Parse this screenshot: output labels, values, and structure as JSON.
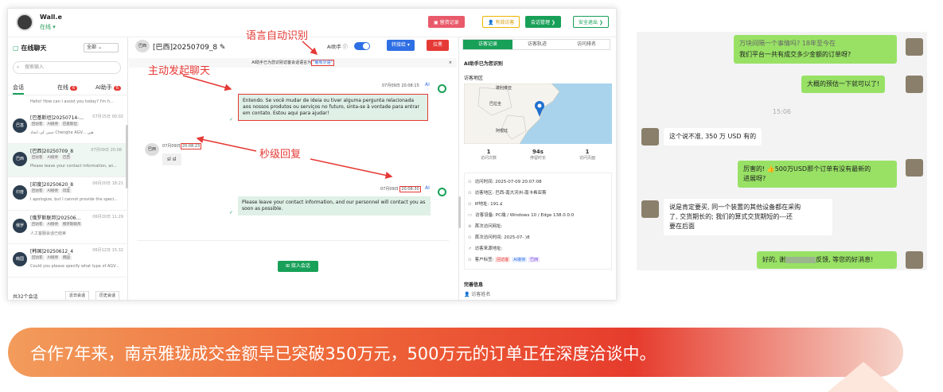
{
  "topbar": {
    "user_name": "Wall.e",
    "user_status": "在线 ▾",
    "btn_leave_record": "▣ 留资记录",
    "btn_visitor": "👤 有效访客",
    "btn_session_mgmt": "会话管理 ❯",
    "btn_safe_exit": "安全退出 ❯"
  },
  "left": {
    "title": "在线聊天",
    "filter": "全部",
    "search_placeholder": "搜索输入",
    "tabs": [
      {
        "label": "会话",
        "badge": ""
      },
      {
        "label": "在线",
        "badge": "6"
      },
      {
        "label": "AI助手",
        "badge": "6"
      }
    ],
    "first_preview": "Hello! How can I assist you today? I'm h...",
    "conversations": [
      {
        "avatar": "巴基",
        "title": "[巴基斯坦]20250714-...",
        "time": "07月15日 00:02",
        "tags": [
          "回访客",
          "AI接待",
          "巴基斯坦"
        ],
        "msg": "چینی کی اتحاد Chenghe AGV... هیں"
      },
      {
        "avatar": "巴西",
        "title": "[巴西]20250709_8",
        "time": "07月09日 20:08",
        "tags": [
          "回访客",
          "AI接待",
          "巴西"
        ],
        "msg": "Please leave your contact information, an..."
      },
      {
        "avatar": "印度",
        "title": "[印度]20250620_8",
        "time": "06月20日 18:21",
        "tags": [
          "回访客",
          "AI接待",
          "印度"
        ],
        "msg": "I apologize, but I cannot provide the speci..."
      },
      {
        "avatar": "俄罗",
        "title": "[俄罗斯联邦]202506...",
        "time": "06月20日 11:29",
        "tags": [
          "回访客",
          "AI接待",
          "俄罗斯联邦"
        ],
        "msg": "人工客服会话已结束"
      },
      {
        "avatar": "韩国",
        "title": "[韩国]20250612_4",
        "time": "06月12日 15:32",
        "tags": [
          "回访客",
          "AI接待",
          "韩国"
        ],
        "msg": "Could you please specify what type of AGV..."
      }
    ],
    "total": "共32个会话",
    "btn_recent": "近日会话",
    "btn_history": "历史会话"
  },
  "chat": {
    "avatar": "巴西",
    "title": "[巴西]20250709_8 ✎",
    "ai_label": "AI助手 ⓘ",
    "btn_transfer": "转接给 ▾",
    "btn_block": "拉黑",
    "notice_prefix": "AI助手已为您识别访客会话语言为",
    "notice_lang": "\"葡萄牙语\"",
    "close": "×",
    "msg1_time": "07月09日 20:08:15",
    "msg1_ai": "AI",
    "msg1_text": "Entendo. Se você mudar de ideia ou tiver alguma pergunta relacionada aos nossos produtos ou serviços no futuro, sinta-se à vontade para entrar em contato. Estou aqui para ajudar!",
    "visitor_avatar": "巴西",
    "msg2_date": "07月09日",
    "msg2_time": "20:08:23",
    "msg2_text": "sl sl",
    "msg3_date": "07月09日",
    "msg3_time": "20:08:30",
    "msg3_ai": "AI",
    "msg3_text": "Please leave your contact information, and our personnel will contact you as soon as possible.",
    "btn_accept": "⊞ 接入会话"
  },
  "right": {
    "tabs": [
      "访客记录",
      "访客轨迹",
      "访问排名"
    ],
    "ai_recog": "AI助手已为您识别",
    "region_label": "访客地区",
    "map_labels": [
      "玻利维亚",
      "巴拉圭",
      "阿根廷"
    ],
    "stats": [
      {
        "value": "1",
        "label": "访问次数"
      },
      {
        "value": "94s",
        "label": "停留时长"
      },
      {
        "value": "1",
        "label": "访问页面"
      }
    ],
    "info": [
      {
        "icon": "⊙",
        "text": "访问时间:  2025-07-09 20:07:08"
      },
      {
        "icon": "⊙",
        "text": "访客地区:  巴西-南大河州-南卡希亚斯"
      },
      {
        "icon": "⊙",
        "text": "IP地址:  191.£"
      },
      {
        "icon": "▭",
        "text": "访客设备:  PC端 / Windows 10 / Edge 138.0.0.0"
      },
      {
        "icon": "⊕",
        "text": "首次访问网址:"
      },
      {
        "icon": "⊙",
        "text": "首次访问时间:  2025-07-       )8"
      },
      {
        "icon": "➚",
        "text": "访客来源地址:"
      }
    ],
    "tag_label": "客户标签:",
    "tags": [
      "回访客",
      "AI接待",
      "巴西"
    ],
    "leave_info": "完善信息",
    "visitor_name": "访客姓名"
  },
  "annotations": {
    "lang_auto": "语言自动识别",
    "proactive": "主动发起聊天",
    "second_reply": "秒级回复"
  },
  "wechat": {
    "msg_top": "我们平台一共有成交多少金额的订单呀?",
    "msg_top_ghost": "万块间隔一个事情吗? 18年至今在",
    "msg_estimate": "大概的预估一下就可以了!",
    "time": "15:06",
    "msg_350": "这个说不准, 350 万 USD 有的",
    "msg_500_a": "厉害的! 👍500万USD那个订单有没有最新的",
    "msg_500_b": "进展呀?",
    "msg_buy_a": "说是肯定要买, 同一个装置的其他设备都在采购",
    "msg_buy_b": "了, 交货期长的; 我们的算式交货期短的---还",
    "msg_buy_c": "要在后面",
    "msg_good_a": "好的, 谢",
    "msg_good_b": "反馈, 等您的好消息!"
  },
  "banner": {
    "text": "合作7年来，南京雅珑成交金额早已突破350万元，500万元的订单正在深度洽谈中。"
  }
}
